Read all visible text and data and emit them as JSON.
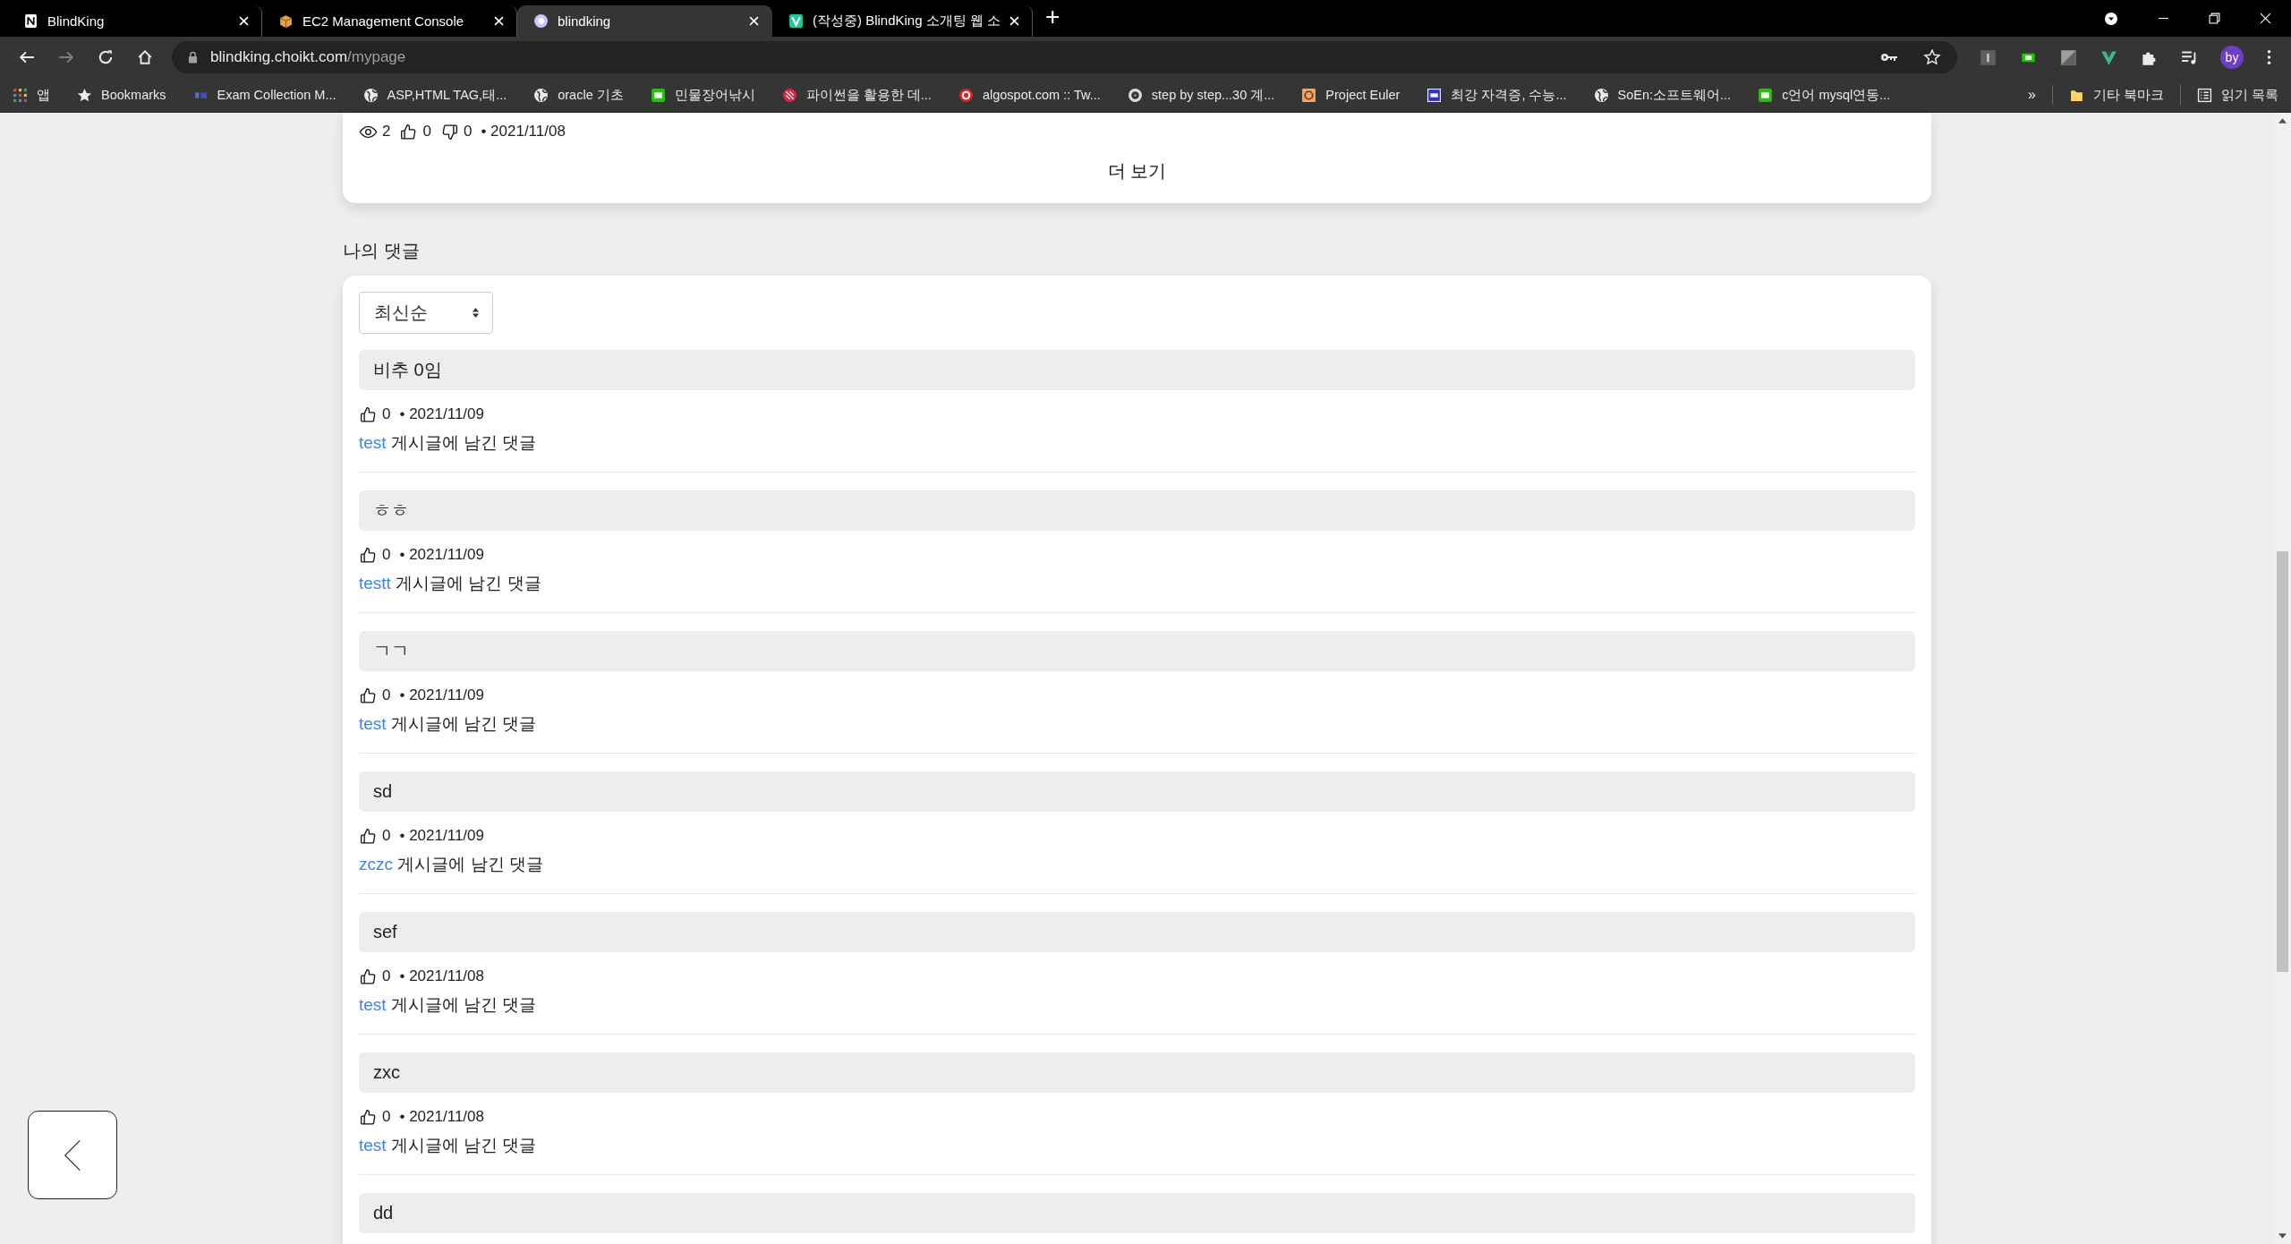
{
  "browser": {
    "tabs": [
      {
        "title": "BlindKing",
        "selected": false
      },
      {
        "title": "EC2 Management Console",
        "selected": false
      },
      {
        "title": "blindking",
        "selected": true
      },
      {
        "title": "(작성중) BlindKing 소개팅 웹 소",
        "selected": false
      }
    ],
    "new_tab": "+",
    "address": {
      "host": "blindking.choikt.com",
      "path": "/mypage"
    },
    "profile": "by",
    "bookmarks": [
      {
        "label": "앱"
      },
      {
        "label": "Bookmarks"
      },
      {
        "label": "Exam Collection M..."
      },
      {
        "label": "ASP,HTML TAG,태..."
      },
      {
        "label": "oracle 기초"
      },
      {
        "label": "민물장어낚시"
      },
      {
        "label": "파이썬을 활용한 데..."
      },
      {
        "label": "algospot.com :: Tw..."
      },
      {
        "label": "step by step...30 계..."
      },
      {
        "label": "Project Euler"
      },
      {
        "label": "최강 자격증, 수능..."
      },
      {
        "label": "SoEn:소프트웨어..."
      },
      {
        "label": "c언어 mysql연동..."
      }
    ],
    "overflow": "»",
    "other_bookmarks": "기타 북마크",
    "reading_list": "읽기 목록"
  },
  "post_card": {
    "views": "2",
    "likes": "0",
    "dislikes": "0",
    "date": "• 2021/11/08",
    "more": "더 보기"
  },
  "comments_section": {
    "title": "나의 댓글",
    "sort": {
      "value": "최신순"
    },
    "comments": [
      {
        "text": "비추 0임",
        "likes": "0",
        "date": "• 2021/11/09",
        "post": "test",
        "suffix": "게시글에 남긴 댓글"
      },
      {
        "text": "ㅎㅎ",
        "likes": "0",
        "date": "• 2021/11/09",
        "post": "testt",
        "suffix": "게시글에 남긴 댓글"
      },
      {
        "text": "ㄱㄱ",
        "likes": "0",
        "date": "• 2021/11/09",
        "post": "test",
        "suffix": "게시글에 남긴 댓글"
      },
      {
        "text": "sd",
        "likes": "0",
        "date": "• 2021/11/09",
        "post": "zczc",
        "suffix": "게시글에 남긴 댓글"
      },
      {
        "text": "sef",
        "likes": "0",
        "date": "• 2021/11/08",
        "post": "test",
        "suffix": "게시글에 남긴 댓글"
      },
      {
        "text": "zxc",
        "likes": "0",
        "date": "• 2021/11/08",
        "post": "test",
        "suffix": "게시글에 남긴 댓글"
      },
      {
        "text": "dd"
      }
    ]
  }
}
